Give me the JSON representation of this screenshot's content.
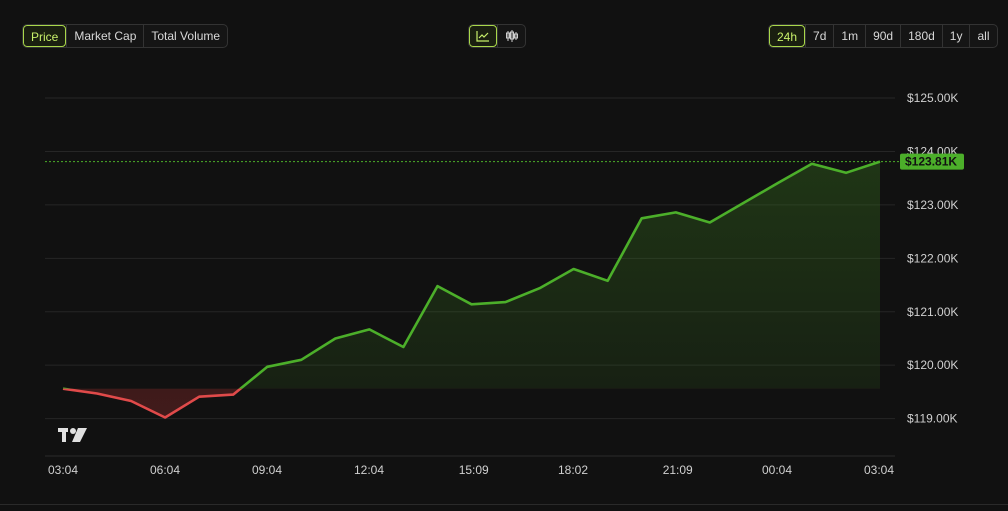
{
  "metric_tabs": [
    {
      "label": "Price",
      "active": true
    },
    {
      "label": "Market Cap",
      "active": false
    },
    {
      "label": "Total Volume",
      "active": false
    }
  ],
  "chart_type_buttons": [
    {
      "icon": "line-chart-icon",
      "active": true
    },
    {
      "icon": "candlestick-icon",
      "active": false
    }
  ],
  "range_tabs": [
    {
      "label": "24h",
      "active": true
    },
    {
      "label": "7d",
      "active": false
    },
    {
      "label": "1m",
      "active": false
    },
    {
      "label": "90d",
      "active": false
    },
    {
      "label": "180d",
      "active": false
    },
    {
      "label": "1y",
      "active": false
    },
    {
      "label": "all",
      "active": false
    }
  ],
  "colors": {
    "up": "#4caf2a",
    "down": "#e04a4a",
    "accent": "#c8f06a",
    "price_tag": "#4caf2a"
  },
  "current_price_label": "$123.81K",
  "chart_data": {
    "type": "area",
    "baseline": 119.56,
    "current": 123.81,
    "y_unit": "thousand USD",
    "ylim": [
      118.3,
      125.6
    ],
    "yticks": [
      125,
      124,
      123,
      122,
      121,
      120,
      119
    ],
    "ytick_labels": [
      "$125.00K",
      "$124.00K",
      "$123.00K",
      "$122.00K",
      "$121.00K",
      "$120.00K",
      "$119.00K"
    ],
    "xtick_labels": [
      "03:04",
      "06:04",
      "09:04",
      "12:04",
      "15:09",
      "18:02",
      "21:09",
      "00:04",
      "03:04"
    ],
    "xlim": [
      0,
      24
    ],
    "xtick_positions": [
      0,
      3,
      6,
      9,
      12.08,
      15,
      18.08,
      21,
      24
    ],
    "grid": true,
    "series": [
      {
        "x": [
          0,
          1,
          2,
          3,
          4,
          5,
          6,
          7,
          8,
          9,
          10,
          11,
          12,
          13,
          14,
          15,
          16,
          17,
          18,
          19,
          20,
          21,
          22,
          23,
          24
        ],
        "values": [
          119.56,
          119.47,
          119.33,
          119.02,
          119.41,
          119.45,
          119.97,
          120.1,
          120.5,
          120.67,
          120.34,
          121.48,
          121.14,
          121.18,
          121.44,
          121.8,
          121.58,
          122.75,
          122.86,
          122.67,
          123.04,
          123.41,
          123.77,
          123.6,
          123.81
        ]
      }
    ]
  }
}
